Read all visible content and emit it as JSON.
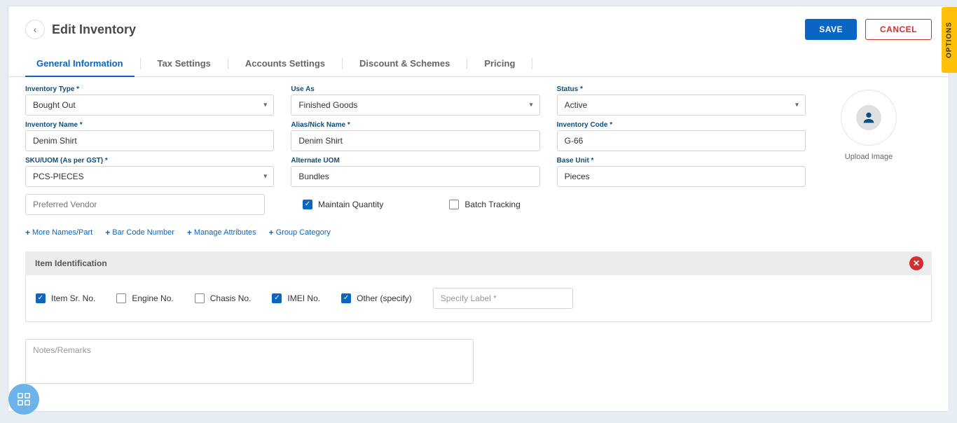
{
  "header": {
    "title": "Edit Inventory",
    "save_label": "SAVE",
    "cancel_label": "CANCEL",
    "options_label": "OPTIONS"
  },
  "tabs": [
    {
      "label": "General Information",
      "active": true
    },
    {
      "label": "Tax Settings",
      "active": false
    },
    {
      "label": "Accounts Settings",
      "active": false
    },
    {
      "label": "Discount & Schemes",
      "active": false
    },
    {
      "label": "Pricing",
      "active": false
    }
  ],
  "fields": {
    "inventory_type": {
      "label": "Inventory Type *",
      "value": "Bought Out"
    },
    "use_as": {
      "label": "Use As",
      "value": "Finished Goods"
    },
    "status": {
      "label": "Status *",
      "value": "Active"
    },
    "inventory_name": {
      "label": "Inventory Name *",
      "value": "Denim Shirt"
    },
    "alias": {
      "label": "Alias/Nick Name *",
      "value": "Denim Shirt"
    },
    "inventory_code": {
      "label": "Inventory Code *",
      "value": "G-66"
    },
    "sku": {
      "label": "SKU/UOM (As per GST) *",
      "value": "PCS-PIECES"
    },
    "alternate_uom": {
      "label": "Alternate UOM",
      "value": "Bundles"
    },
    "base_unit": {
      "label": "Base Unit *",
      "value": "Pieces"
    }
  },
  "vendor": {
    "placeholder": "Preferred Vendor"
  },
  "checkboxes": {
    "maintain_qty": {
      "label": "Maintain Quantity",
      "checked": true
    },
    "batch_tracking": {
      "label": "Batch Tracking",
      "checked": false
    }
  },
  "links": {
    "more_names": "More Names/Part",
    "barcode": "Bar Code Number",
    "manage_attr": "Manage Attributes",
    "group_cat": "Group Category"
  },
  "item_ident": {
    "title": "Item Identification",
    "serial": {
      "label": "Item Sr. No.",
      "checked": true
    },
    "engine": {
      "label": "Engine No.",
      "checked": false
    },
    "chasis": {
      "label": "Chasis No.",
      "checked": false
    },
    "imei": {
      "label": "IMEI No.",
      "checked": true
    },
    "other": {
      "label": "Other (specify)",
      "checked": true
    },
    "specify_placeholder": "Specify Label *"
  },
  "notes_placeholder": "Notes/Remarks",
  "upload_label": "Upload Image"
}
